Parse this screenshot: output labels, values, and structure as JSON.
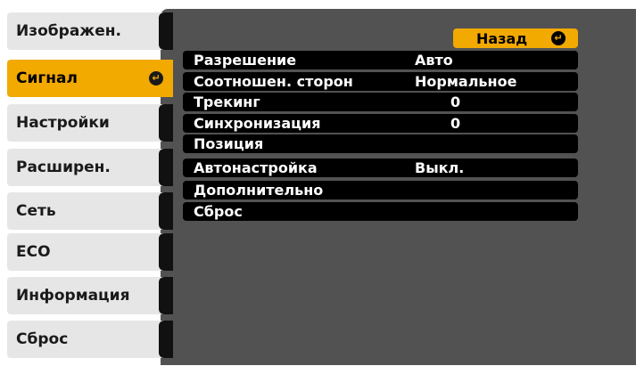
{
  "sidebar": {
    "items": [
      {
        "label": "Изображен.",
        "selected": false
      },
      {
        "label": "Сигнал",
        "selected": true
      },
      {
        "label": "Настройки",
        "selected": false
      },
      {
        "label": "Расширен.",
        "selected": false
      },
      {
        "label": "Сеть",
        "selected": false
      },
      {
        "label": "ECO",
        "selected": false
      },
      {
        "label": "Информация",
        "selected": false
      },
      {
        "label": "Сброс",
        "selected": false
      }
    ]
  },
  "panel": {
    "back_label": "Назад",
    "rows": [
      {
        "label": "Разрешение",
        "value": "Авто"
      },
      {
        "label": "Соотношен. сторон",
        "value": "Нормальное"
      },
      {
        "label": "Трекинг",
        "value": "0"
      },
      {
        "label": "Синхронизация",
        "value": "0"
      },
      {
        "label": "Позиция",
        "value": ""
      },
      {
        "label": "Автонастройка",
        "value": "Выкл."
      },
      {
        "label": "Дополнительно",
        "value": ""
      },
      {
        "label": "Сброс",
        "value": ""
      }
    ]
  },
  "colors": {
    "accent": "#f2a900",
    "panel": "#525252",
    "tab": "#e6e6e6"
  },
  "icons": {
    "enter": "enter-icon"
  }
}
